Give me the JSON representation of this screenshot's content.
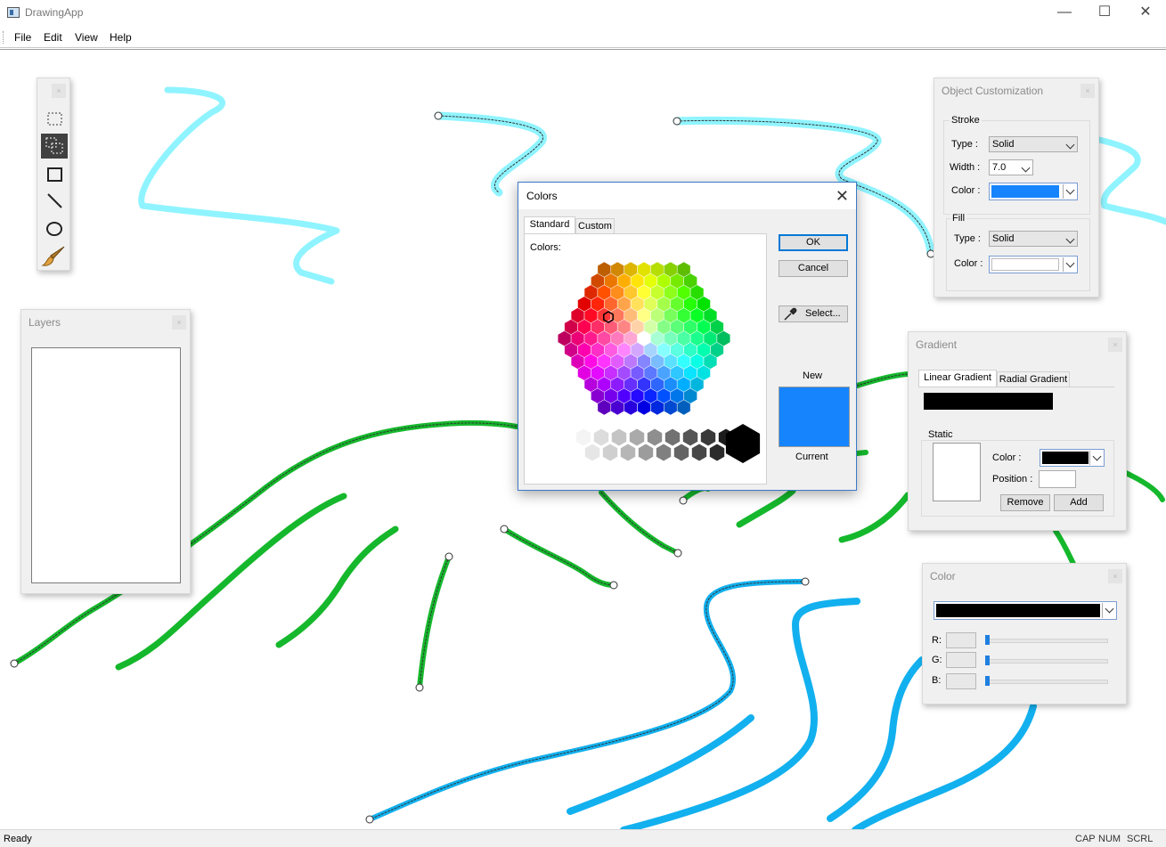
{
  "window": {
    "title": "DrawingApp",
    "minimize": "—",
    "maximize": "☐",
    "close": "✕"
  },
  "menu": {
    "items": [
      "File",
      "Edit",
      "View",
      "Help"
    ]
  },
  "toolbox": {
    "close": "×",
    "tools": [
      "rect-select",
      "multi-select",
      "rectangle",
      "line",
      "ellipse",
      "brush"
    ],
    "active_tool": "multi-select"
  },
  "layers": {
    "title": "Layers",
    "close": "×"
  },
  "colors_dialog": {
    "title": "Colors",
    "close": "✕",
    "tabs": [
      "Standard",
      "Custom"
    ],
    "active_tab": "Standard",
    "colors_label": "Colors:",
    "ok": "OK",
    "cancel": "Cancel",
    "select": "Select...",
    "new_label": "New",
    "current_label": "Current",
    "new_color": "#1684fc"
  },
  "object_customization": {
    "title": "Object Customization",
    "close": "×",
    "stroke": {
      "label": "Stroke",
      "type_label": "Type :",
      "type_value": "Solid",
      "width_label": "Width :",
      "width_value": "7.0",
      "color_label": "Color :",
      "color_value": "#1684fc"
    },
    "fill": {
      "label": "Fill",
      "type_label": "Type :",
      "type_value": "Solid",
      "color_label": "Color :",
      "color_value": "#ffffff"
    }
  },
  "gradient": {
    "title": "Gradient",
    "close": "×",
    "tabs": [
      "Linear Gradient",
      "Radial Gradient"
    ],
    "active_tab": "Linear Gradient",
    "preview_color": "#000000",
    "static_label": "Static",
    "color_label": "Color :",
    "color_value": "#000000",
    "position_label": "Position :",
    "position_value": "",
    "remove": "Remove",
    "add": "Add"
  },
  "color_panel": {
    "title": "Color",
    "close": "×",
    "selected": "#000000",
    "channels": [
      {
        "label": "R:",
        "value": "",
        "level": 0
      },
      {
        "label": "G:",
        "value": "",
        "level": 0
      },
      {
        "label": "B:",
        "value": "",
        "level": 0
      }
    ]
  },
  "status": {
    "text": "Ready",
    "cap": "CAP",
    "num": "NUM",
    "scrl": "SCRL"
  },
  "colors": {
    "cyan_stroke": "#8ff4ff",
    "green_stroke": "#15b82c",
    "blue_stroke": "#12b0ee"
  }
}
